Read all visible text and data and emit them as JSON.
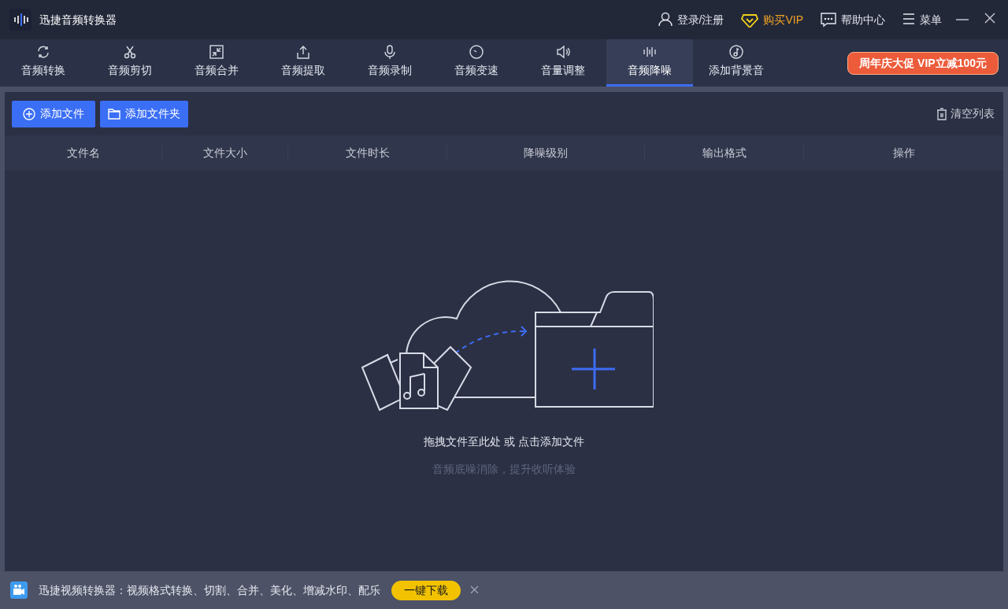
{
  "app": {
    "title": "迅捷音频转换器"
  },
  "top_actions": [
    {
      "kind": "user",
      "label": "登录/注册"
    },
    {
      "kind": "vip",
      "label": "购买VIP"
    },
    {
      "kind": "help",
      "label": "帮助中心"
    },
    {
      "kind": "menu",
      "label": "菜单"
    }
  ],
  "tabs": [
    {
      "label": "音频转换",
      "selected": false
    },
    {
      "label": "音频剪切",
      "selected": false
    },
    {
      "label": "音频合并",
      "selected": false
    },
    {
      "label": "音频提取",
      "selected": false
    },
    {
      "label": "音频录制",
      "selected": false
    },
    {
      "label": "音频变速",
      "selected": false
    },
    {
      "label": "音量调整",
      "selected": false
    },
    {
      "label": "音频降噪",
      "selected": true
    },
    {
      "label": "添加背景音",
      "selected": false
    }
  ],
  "promo_banner": "周年庆大促 VIP立减100元",
  "toolbar": {
    "add_file": "添加文件",
    "add_folder": "添加文件夹",
    "clear_list": "清空列表"
  },
  "table": {
    "columns": [
      "文件名",
      "文件大小",
      "文件时长",
      "降噪级别",
      "输出格式",
      "操作"
    ]
  },
  "empty_state": {
    "hint": "拖拽文件至此处 或 点击添加文件",
    "subtitle": "音频底噪消除，提升收听体验"
  },
  "ad_bar": {
    "text": "迅捷视频转换器：视频格式转换、切割、合并、美化、增减水印、配乐",
    "button": "一键下载"
  }
}
